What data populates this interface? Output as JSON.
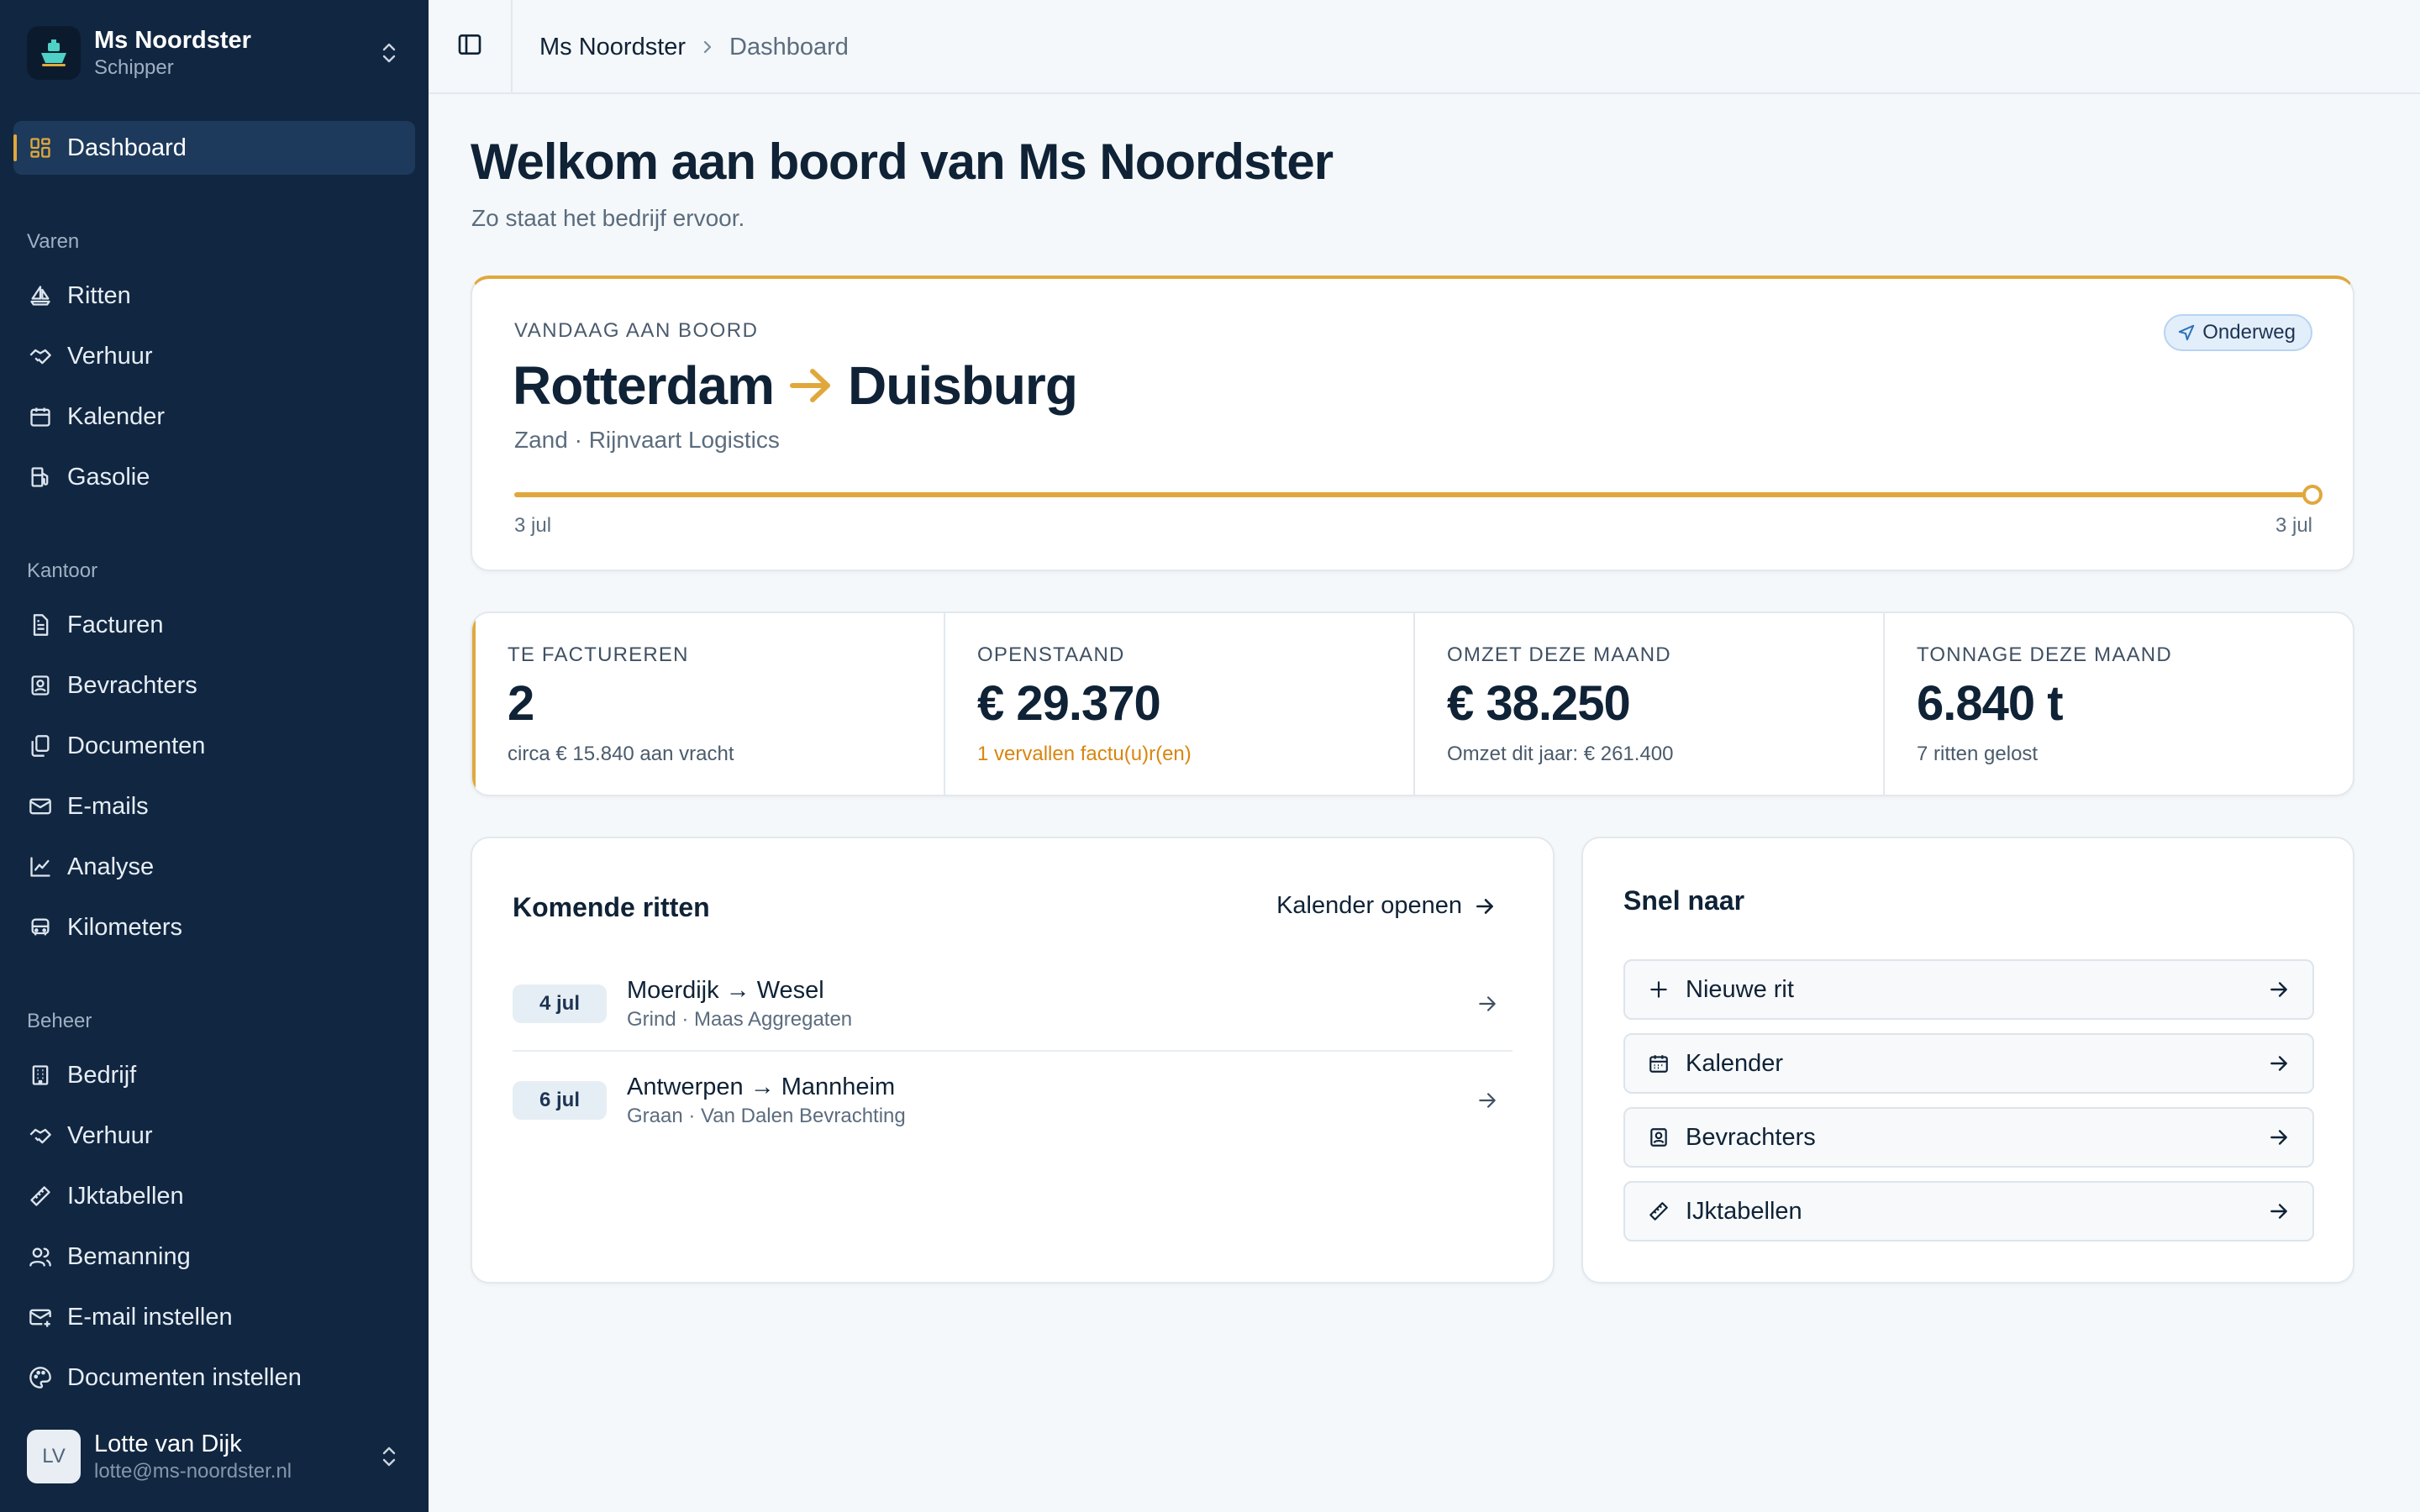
{
  "colors": {
    "sidebar_bg": "#112640",
    "accent": "#e0a83c",
    "page_bg": "#f5f8fa",
    "status_badge": "#e3eefb",
    "warning": "#d9850f"
  },
  "sidebar": {
    "ship": {
      "name": "Ms Noordster",
      "role": "Schipper",
      "icon": "ship-icon"
    },
    "active": {
      "label": "Dashboard",
      "icon": "dashboard-icon"
    },
    "sections": [
      {
        "label": "Varen",
        "items": [
          {
            "label": "Ritten",
            "icon": "sailboat-icon"
          },
          {
            "label": "Verhuur",
            "icon": "handshake-icon"
          },
          {
            "label": "Kalender",
            "icon": "calendar-icon"
          },
          {
            "label": "Gasolie",
            "icon": "fuel-icon"
          }
        ]
      },
      {
        "label": "Kantoor",
        "items": [
          {
            "label": "Facturen",
            "icon": "invoice-icon"
          },
          {
            "label": "Bevrachters",
            "icon": "contact-icon"
          },
          {
            "label": "Documenten",
            "icon": "documents-icon"
          },
          {
            "label": "E-mails",
            "icon": "mail-icon"
          },
          {
            "label": "Analyse",
            "icon": "chart-icon"
          },
          {
            "label": "Kilometers",
            "icon": "bus-icon"
          }
        ]
      },
      {
        "label": "Beheer",
        "items": [
          {
            "label": "Bedrijf",
            "icon": "building-icon"
          },
          {
            "label": "Verhuur",
            "icon": "handshake-icon"
          },
          {
            "label": "IJktabellen",
            "icon": "ruler-icon"
          },
          {
            "label": "Bemanning",
            "icon": "users-icon"
          },
          {
            "label": "E-mail instellen",
            "icon": "mail-settings-icon"
          },
          {
            "label": "Documenten instellen",
            "icon": "palette-icon"
          }
        ]
      }
    ],
    "user": {
      "initials": "LV",
      "name": "Lotte van Dijk",
      "email": "lotte@ms-noordster.nl"
    }
  },
  "topbar": {
    "breadcrumb": [
      "Ms Noordster",
      "Dashboard"
    ]
  },
  "main": {
    "title": "Welkom aan boord van Ms Noordster",
    "subtitle": "Zo staat het bedrijf ervoor.",
    "trip": {
      "eyebrow": "VANDAAG AAN BOORD",
      "status": "Onderweg",
      "from": "Rotterdam",
      "to": "Duisburg",
      "meta": "Zand · Rijnvaart Logistics",
      "progress": 1.0,
      "date_start": "3 jul",
      "date_end": "3 jul"
    },
    "stats": [
      {
        "label": "TE FACTUREREN",
        "value": "2",
        "note": "circa € 15.840 aan vracht",
        "warn": false
      },
      {
        "label": "OPENSTAAND",
        "value": "€ 29.370",
        "note": "1 vervallen factu(u)r(en)",
        "warn": true
      },
      {
        "label": "OMZET DEZE MAAND",
        "value": "€ 38.250",
        "note": "Omzet dit jaar: € 261.400",
        "warn": false
      },
      {
        "label": "TONNAGE DEZE MAAND",
        "value": "6.840 t",
        "note": "7 ritten gelost",
        "warn": false
      }
    ],
    "rides": {
      "title": "Komende ritten",
      "link": "Kalender openen",
      "items": [
        {
          "date": "4 jul",
          "route": "Moerdijk → Wesel",
          "meta": "Grind · Maas Aggregaten"
        },
        {
          "date": "6 jul",
          "route": "Antwerpen → Mannheim",
          "meta": "Graan · Van Dalen Bevrachting"
        }
      ]
    },
    "quick": {
      "title": "Snel naar",
      "items": [
        {
          "label": "Nieuwe rit",
          "icon": "plus-icon"
        },
        {
          "label": "Kalender",
          "icon": "calendar-icon"
        },
        {
          "label": "Bevrachters",
          "icon": "contact-icon"
        },
        {
          "label": "IJktabellen",
          "icon": "ruler-icon"
        }
      ]
    }
  }
}
